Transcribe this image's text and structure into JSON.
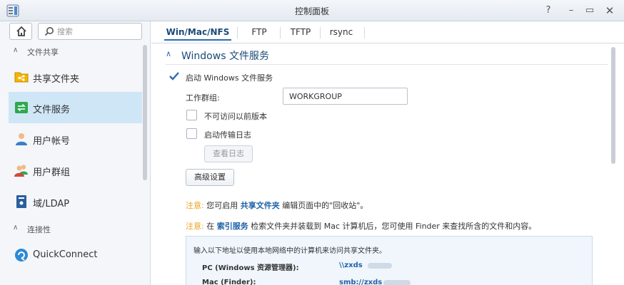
{
  "window": {
    "title": "控制面板",
    "help": "?",
    "minimize": "–",
    "maximize": "▭",
    "close": "✕"
  },
  "sidebar": {
    "search_placeholder": "搜索",
    "groups": [
      {
        "label": "文件共享",
        "items": [
          {
            "label": "共享文件夹",
            "icon": "share-folder-icon"
          },
          {
            "label": "文件服务",
            "icon": "file-services-icon",
            "active": true
          },
          {
            "label": "用户帐号",
            "icon": "user-icon"
          },
          {
            "label": "用户群组",
            "icon": "group-icon"
          },
          {
            "label": "域/LDAP",
            "icon": "domain-ldap-icon"
          }
        ]
      },
      {
        "label": "连接性",
        "items": [
          {
            "label": "QuickConnect",
            "icon": "quickconnect-icon"
          }
        ]
      }
    ]
  },
  "tabs": [
    {
      "label": "Win/Mac/NFS",
      "active": true
    },
    {
      "label": "FTP"
    },
    {
      "label": "TFTP"
    },
    {
      "label": "rsync"
    }
  ],
  "section": {
    "title": "Windows 文件服务",
    "enable_label": "启动 Windows 文件服务",
    "enable_checked": true,
    "workgroup_label": "工作群组:",
    "workgroup_value": "WORKGROUP",
    "prev_versions_label": "不可访问以前版本",
    "prev_versions_checked": false,
    "transfer_log_label": "启动传输日志",
    "transfer_log_checked": false,
    "view_log_button": "查看日志",
    "advanced_button": "高级设置"
  },
  "notes": {
    "note1": {
      "key": "注意:",
      "pre": "您可启用",
      "link": "共享文件夹",
      "post": "编辑页面中的\"回收站\"。"
    },
    "note2": {
      "key": "注意:",
      "pre": "在",
      "link": "索引服务",
      "post": "检索文件夹并装载到 Mac 计算机后，您可使用 Finder 来查找所含的文件和内容。"
    }
  },
  "infobox": {
    "intro": "输入以下地址以使用本地网络中的计算机来访问共享文件夹。",
    "pc_label": "PC (Windows 资源管理器):",
    "pc_value": "\\\\zxds",
    "mac_label": "Mac (Finder):",
    "mac_value": "smb://zxds"
  },
  "colors": {
    "accent": "#2b6cb0",
    "active_bg": "#cfe6f7",
    "note_key": "#f0a020",
    "link": "#1f62a8"
  }
}
